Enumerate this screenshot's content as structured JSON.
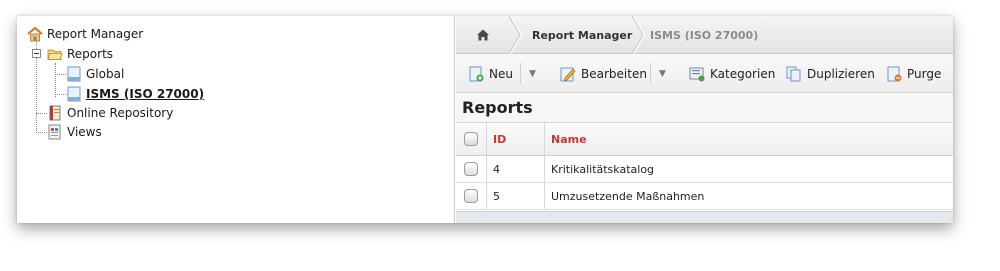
{
  "tree": {
    "root": "Report Manager",
    "reports": "Reports",
    "global": "Global",
    "isms": "ISMS (ISO 27000)",
    "online_repository": "Online Repository",
    "views": "Views"
  },
  "breadcrumb": {
    "home_icon": "home-icon",
    "item1": "Report Manager",
    "item2": "ISMS (ISO 27000)"
  },
  "toolbar": {
    "new_label": "Neu",
    "edit_label": "Bearbeiten",
    "categories_label": "Kategorien",
    "duplicate_label": "Duplizieren",
    "purge_label": "Purge"
  },
  "panel": {
    "title": "Reports"
  },
  "table": {
    "columns": [
      "ID",
      "Name"
    ],
    "rows": [
      {
        "id": "4",
        "name": "Kritikalitätskatalog"
      },
      {
        "id": "5",
        "name": "Umzusetzende Maßnahmen"
      }
    ]
  },
  "colors": {
    "header_text": "#c43a2f",
    "crumb_active": "#8a8a8a"
  }
}
